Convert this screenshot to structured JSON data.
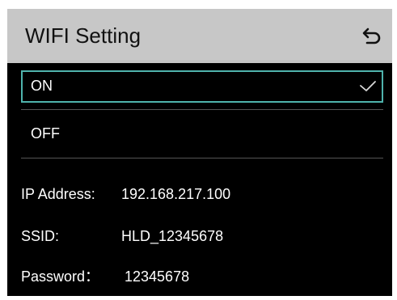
{
  "header": {
    "title": "WIFI Setting",
    "back_icon": "return-icon"
  },
  "options": [
    {
      "label": "ON",
      "selected": true,
      "icon": "check-icon"
    },
    {
      "label": "OFF",
      "selected": false
    }
  ],
  "info": {
    "ip_label": "IP Address:",
    "ip_value": "192.168.217.100",
    "ssid_label": "SSID:",
    "ssid_value": "HLD_12345678",
    "password_label": "Password：",
    "password_value": "12345678"
  },
  "colors": {
    "header_bg": "#c7c7c7",
    "screen_bg": "#000000",
    "accent": "#4fb3ac",
    "text": "#ffffff"
  }
}
